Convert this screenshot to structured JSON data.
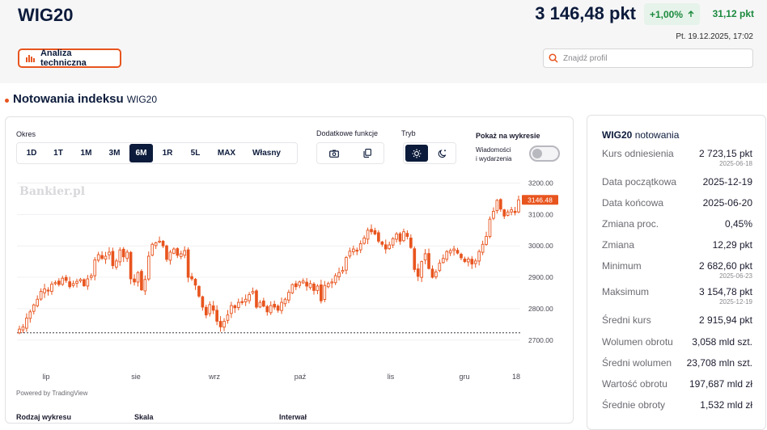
{
  "header": {
    "ticker": "WIG20",
    "price": "3 146,48 pkt",
    "change_pct": "+1,00%",
    "change_abs": "31,12 pkt",
    "datetime": "Pt. 19.12.2025, 17:02",
    "tech_button": "Analiza techniczna",
    "search_placeholder": "Znajdź profil",
    "up_color": "#1c8a3e",
    "accent": "#e8541e"
  },
  "section": {
    "title": "Notowania indeksu",
    "subtitle": "WIG20"
  },
  "controls": {
    "okres_label": "Okres",
    "ranges": [
      {
        "label": "1D",
        "active": false
      },
      {
        "label": "1T",
        "active": false
      },
      {
        "label": "1M",
        "active": false
      },
      {
        "label": "3M",
        "active": false
      },
      {
        "label": "6M",
        "active": true
      },
      {
        "label": "1R",
        "active": false
      },
      {
        "label": "5L",
        "active": false
      },
      {
        "label": "MAX",
        "active": false
      },
      {
        "label": "Własny",
        "active": false
      }
    ],
    "functions_label": "Dodatkowe funkcje",
    "mode_label": "Tryb",
    "show_label": "Pokaż na wykresie",
    "news_label_1": "Wiadomości",
    "news_label_2": "i wydarzenia",
    "news_toggle_on": false,
    "powered_by": "Powered by TradingView",
    "bottom_labels": [
      "Rodzaj wykresu",
      "Skala",
      "Interwał"
    ],
    "icons": [
      "camera-icon",
      "copy-icon",
      "sun-icon",
      "moon-icon"
    ]
  },
  "chart_data": {
    "type": "candlestick",
    "watermark": "Bankier.pl",
    "ylim": [
      2675,
      3210
    ],
    "yticks": [
      "3200.00",
      "3100.00",
      "3000.00",
      "2900.00",
      "2800.00",
      "2700.00"
    ],
    "ytick_values": [
      3200,
      3100,
      3000,
      2900,
      2800,
      2700
    ],
    "xticks": [
      "lip",
      "sie",
      "wrz",
      "paź",
      "lis",
      "gru",
      "18"
    ],
    "last_price_label": "3146.48",
    "baseline_value": 2723.15,
    "up_color": "#e8541e",
    "closes": [
      2735,
      2742,
      2770,
      2790,
      2812,
      2830,
      2855,
      2863,
      2858,
      2878,
      2883,
      2877,
      2897,
      2890,
      2870,
      2880,
      2887,
      2893,
      2873,
      2895,
      2905,
      2955,
      2972,
      2960,
      2967,
      2980,
      2937,
      2952,
      2987,
      2965,
      2980,
      2895,
      2885,
      2915,
      2860,
      2893,
      2967,
      3005,
      3010,
      3015,
      3000,
      2957,
      2980,
      2990,
      2970,
      2975,
      2985,
      2900,
      2895,
      2875,
      2840,
      2805,
      2780,
      2813,
      2795,
      2760,
      2742,
      2760,
      2780,
      2810,
      2803,
      2820,
      2822,
      2830,
      2845,
      2855,
      2805,
      2820,
      2808,
      2790,
      2810,
      2805,
      2795,
      2820,
      2830,
      2852,
      2877,
      2870,
      2885,
      2888,
      2872,
      2880,
      2858,
      2872,
      2825,
      2874,
      2880,
      2885,
      2905,
      2915,
      2922,
      2963,
      2983,
      2990,
      2985,
      3007,
      3025,
      3050,
      3045,
      3038,
      3015,
      3005,
      2990,
      3003,
      3023,
      3038,
      3015,
      3045,
      3030,
      2995,
      2925,
      2903,
      2950,
      2975,
      2928,
      2900,
      2917,
      2945,
      2960,
      2982,
      2985,
      2990,
      2977,
      2962,
      2950,
      2958,
      2942,
      2952,
      2982,
      3005,
      3030,
      3085,
      3110,
      3145,
      3117,
      3095,
      3108,
      3115,
      3106,
      3146.48
    ]
  },
  "stats": {
    "title_bold": "WIG20",
    "title_rest": "notowania",
    "rows": [
      {
        "label": "Kurs odniesienia",
        "value": "2 723,15 pkt",
        "date": "2025-06-18"
      },
      {
        "label": "Data początkowa",
        "value": "2025-12-19",
        "date": ""
      },
      {
        "label": "Data końcowa",
        "value": "2025-06-20",
        "date": ""
      },
      {
        "label": "Zmiana proc.",
        "value": "0,45%",
        "date": ""
      },
      {
        "label": "Zmiana",
        "value": "12,29 pkt",
        "date": ""
      },
      {
        "label": "Minimum",
        "value": "2 682,60 pkt",
        "date": "2025-06-23"
      },
      {
        "label": "Maksimum",
        "value": "3 154,78 pkt",
        "date": "2025-12-19"
      },
      {
        "label": "Średni kurs",
        "value": "2 915,94 pkt",
        "date": ""
      },
      {
        "label": "Wolumen obrotu",
        "value": "3,058 mld szt.",
        "date": ""
      },
      {
        "label": "Średni wolumen",
        "value": "23,708 mln szt.",
        "date": ""
      },
      {
        "label": "Wartość obrotu",
        "value": "197,687 mld zł",
        "date": ""
      },
      {
        "label": "Średnie obroty",
        "value": "1,532 mld zł",
        "date": ""
      }
    ]
  }
}
